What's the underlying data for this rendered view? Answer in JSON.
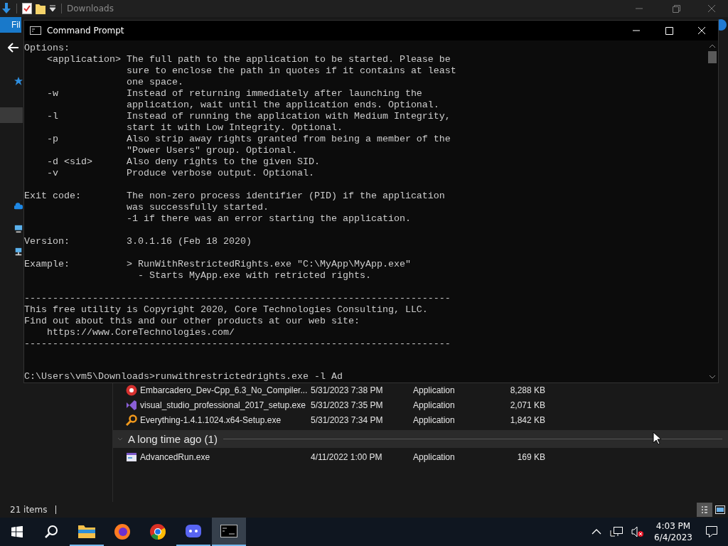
{
  "explorer": {
    "title": "Downloads",
    "ribbon_tab": "Fil",
    "nav_items": [
      {
        "kind": "star",
        "selected": false
      },
      {
        "kind": "blank",
        "selected": true
      },
      {
        "kind": "cloud",
        "selected": false
      },
      {
        "kind": "pc",
        "selected": false
      },
      {
        "kind": "network",
        "selected": false
      }
    ],
    "rows": [
      {
        "name": "Embarcadero_Dev-Cpp_6.3_No_Compiler...",
        "date": "5/31/2023 7:38 PM",
        "type": "Application",
        "size": "8,288 KB",
        "kind": "badge"
      },
      {
        "name": "visual_studio_professional_2017_setup.exe",
        "date": "5/31/2023 7:35 PM",
        "type": "Application",
        "size": "2,071 KB",
        "kind": "ribbon"
      },
      {
        "name": "Everything-1.4.1.1024.x64-Setup.exe",
        "date": "5/31/2023 7:34 PM",
        "type": "Application",
        "size": "1,842 KB",
        "kind": "magnifier"
      }
    ],
    "groups": [
      {
        "title": "A long time ago (1)",
        "expanded": true,
        "rows": [
          {
            "name": "AdvancedRun.exe",
            "date": "4/11/2022 1:00 PM",
            "type": "Application",
            "size": "169 KB",
            "kind": "window"
          }
        ]
      }
    ],
    "status": "21 items",
    "views": [
      {
        "kind": "details",
        "selected": true
      },
      {
        "kind": "tiles",
        "selected": false
      }
    ]
  },
  "console": {
    "title": "Command Prompt",
    "blocks": [
      "Options:\n    <application> The full path to the application to be started. Please be\n                  sure to enclose the path in quotes if it contains at least\n                  one space.\n    -w            Instead of returning immediately after launching the\n                  application, wait until the application ends. Optional.\n    -l            Instead of running the application with Medium Integrity,\n                  start it with Low Integrity. Optional.\n    -p            Also strip away rights granted from being a member of the\n                  \"Power Users\" group. Optional.\n    -d <sid>      Also deny rights to the given SID.\n    -v            Produce verbose output. Optional.",
      "Exit code:        The non-zero process identifier (PID) if the application\n                  was successfully started.\n                  -1 if there was an error starting the application.",
      "Version:          3.0.1.16 (Feb 18 2020)",
      "Example:          > RunWithRestrictedRights.exe \"C:\\MyApp\\MyApp.exe\"\n                    - Starts MyApp.exe with retricted rights.",
      "---------------------------------------------------------------------------\nThis free utility is Copyright 2020, Core Technologies Consulting, LLC.\nFind out about this and our other products at our web site:\n    https://www.CoreTechnologies.com/\n---------------------------------------------------------------------------"
    ],
    "prompt_line": "C:\\Users\\vm5\\Downloads>runwithrestrictedrights.exe -l Ad"
  },
  "taskbar": {
    "apps": [
      {
        "kind": "folder",
        "running": true,
        "selected": false
      },
      {
        "kind": "firefox",
        "running": false,
        "selected": false
      },
      {
        "kind": "chrome",
        "running": false,
        "selected": false
      },
      {
        "kind": "discord",
        "running": true,
        "selected": false
      },
      {
        "kind": "terminal",
        "running": true,
        "selected": true
      }
    ],
    "volume_muted": true,
    "time": "4:03 PM",
    "date": "6/4/2023"
  }
}
